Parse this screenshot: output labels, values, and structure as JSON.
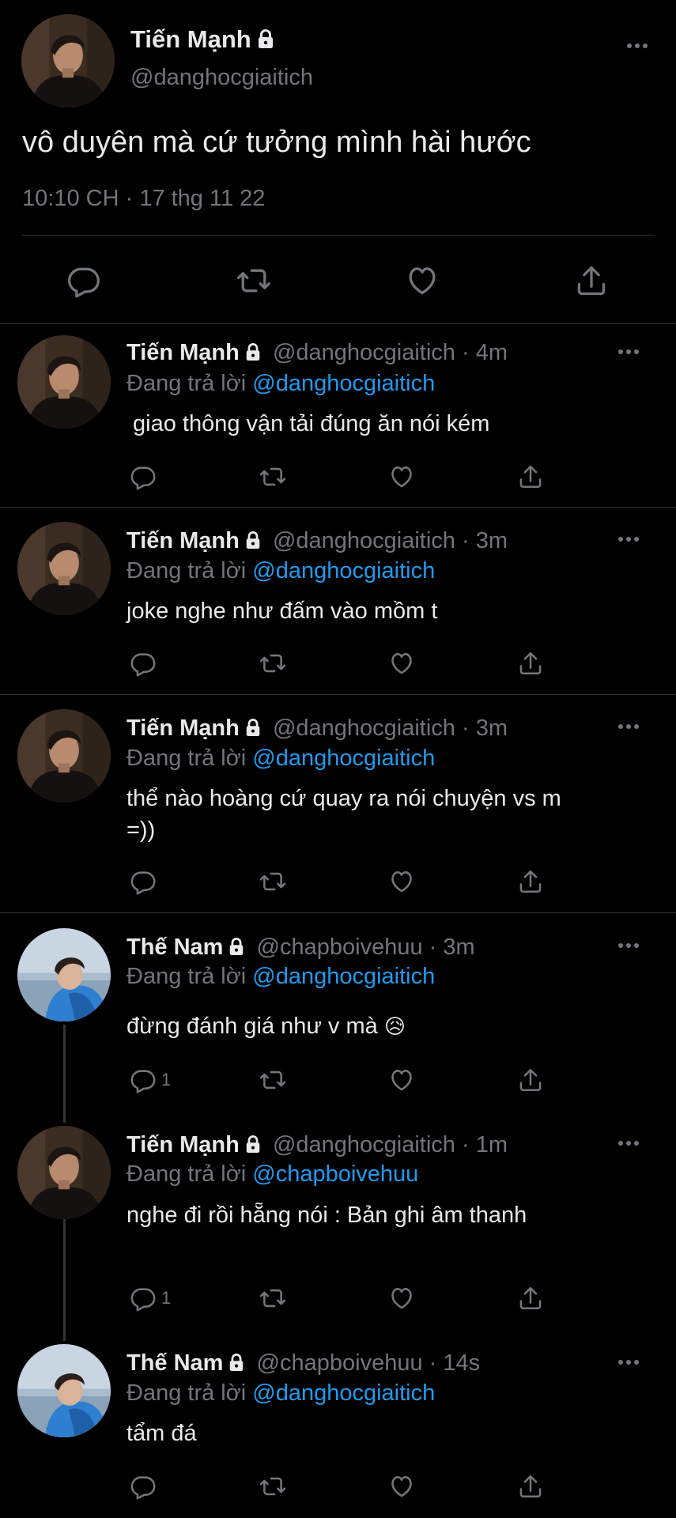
{
  "main_tweet": {
    "name": "Tiến Mạnh",
    "handle": "@danghocgiaitich",
    "text": "vô duyên mà cứ tưởng mình hài hước",
    "time": "10:10 CH",
    "sep": "·",
    "date": "17 thg 11 22"
  },
  "replies": [
    {
      "name": "Tiến Mạnh",
      "handle": "@danghocgiaitich",
      "sep": "·",
      "age": "4m",
      "replying_prefix": "Đang trả lời",
      "replying_to": "@danghocgiaitich",
      "text": "giao thông vận tải đúng ăn nói kém",
      "reply_count": ""
    },
    {
      "name": "Tiến Mạnh",
      "handle": "@danghocgiaitich",
      "sep": "·",
      "age": "3m",
      "replying_prefix": "Đang trả lời",
      "replying_to": "@danghocgiaitich",
      "text": "joke nghe như đấm vào mồm t",
      "reply_count": ""
    },
    {
      "name": "Tiến Mạnh",
      "handle": "@danghocgiaitich",
      "sep": "·",
      "age": "3m",
      "replying_prefix": "Đang trả lời",
      "replying_to": "@danghocgiaitich",
      "text_line1": "thể nào hoàng cứ quay ra nói chuyện vs m",
      "text_line2": "=))",
      "reply_count": ""
    },
    {
      "name": "Thế Nam",
      "handle": "@chapboivehuu",
      "sep": "·",
      "age": "3m",
      "replying_prefix": "Đang trả lời",
      "replying_to": "@danghocgiaitich",
      "text": "đừng đánh giá như v mà",
      "emoji": "😥",
      "reply_count": "1"
    },
    {
      "name": "Tiến Mạnh",
      "handle": "@danghocgiaitich",
      "sep": "·",
      "age": "1m",
      "replying_prefix": "Đang trả lời",
      "replying_to": "@chapboivehuu",
      "text": "nghe đi rồi hẵng nói : Bản ghi âm thanh",
      "reply_count": "1"
    },
    {
      "name": "Thế Nam",
      "handle": "@chapboivehuu",
      "sep": "·",
      "age": "14s",
      "replying_prefix": "Đang trả lời",
      "replying_to": "@danghocgiaitich",
      "text": "tẩm đá",
      "reply_count": ""
    }
  ],
  "icons": {
    "reply": "reply-icon",
    "retweet": "retweet-icon",
    "like": "heart-icon",
    "share": "share-icon",
    "more": "more-icon",
    "lock": "lock-icon"
  },
  "colors": {
    "background": "#000000",
    "text": "#e7e9ea",
    "muted": "#71767b",
    "link": "#1d9bf0",
    "divider": "#2f3336"
  }
}
